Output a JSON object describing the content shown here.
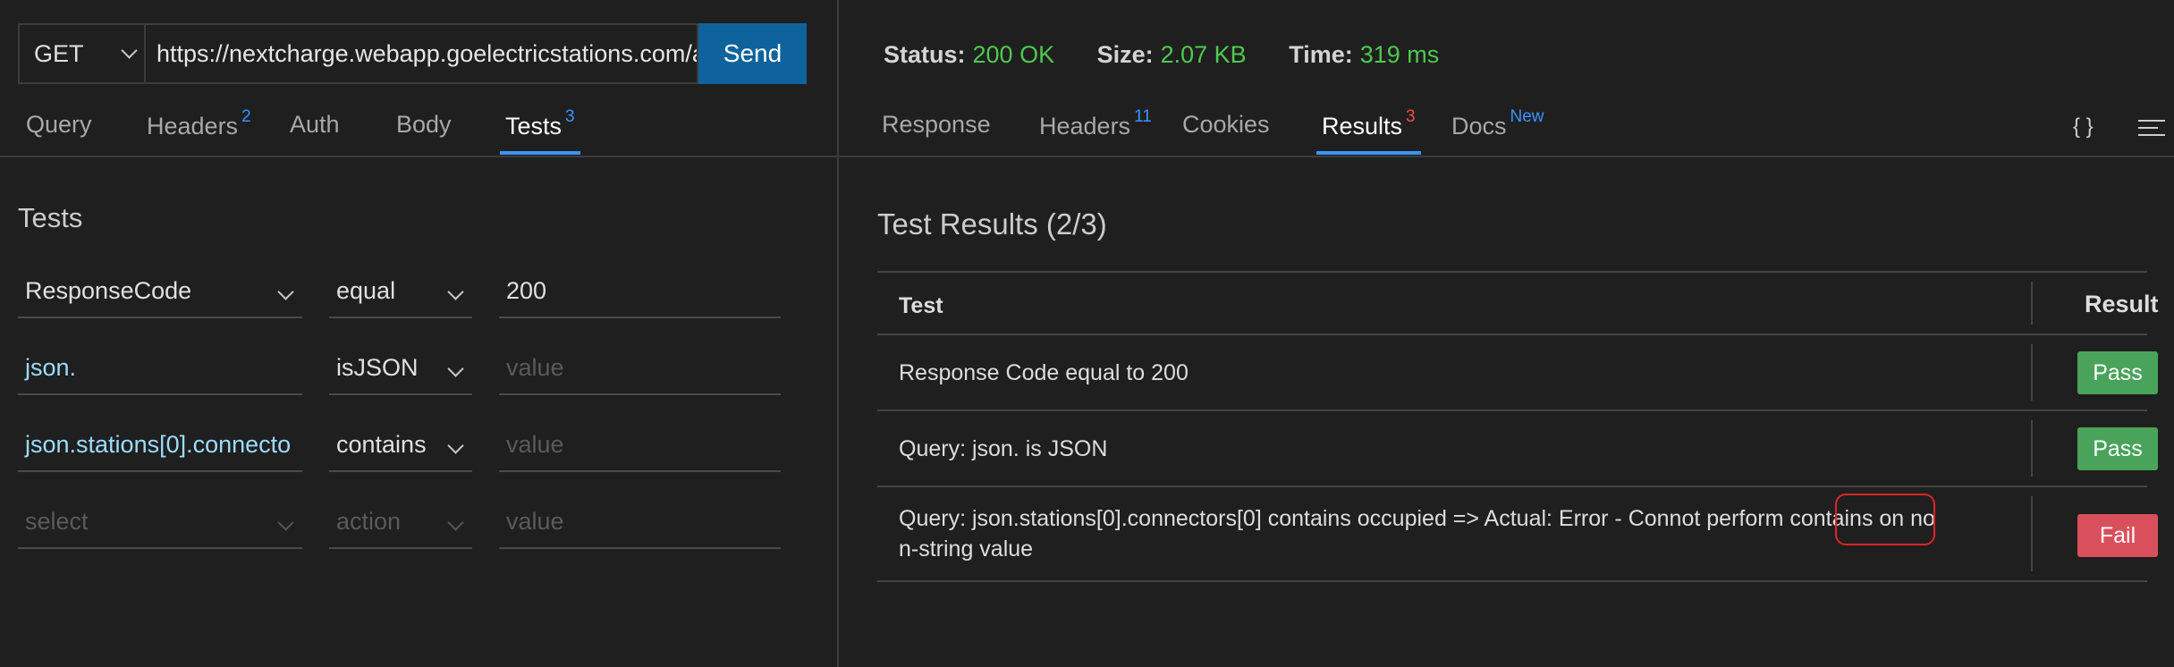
{
  "request": {
    "method": "GET",
    "url": "https://nextcharge.webapp.goelectricstations.com/ap",
    "send_label": "Send"
  },
  "request_tabs": [
    {
      "label": "Query",
      "badge": ""
    },
    {
      "label": "Headers",
      "badge": "2"
    },
    {
      "label": "Auth",
      "badge": ""
    },
    {
      "label": "Body",
      "badge": ""
    },
    {
      "label": "Tests",
      "badge": "3"
    }
  ],
  "tests_section": {
    "title": "Tests",
    "rows": [
      {
        "field": "ResponseCode",
        "action": "equal",
        "value": "200",
        "value_placeholder": ""
      },
      {
        "field": "json.",
        "action": "isJSON",
        "value": "",
        "value_placeholder": "value"
      },
      {
        "field": "json.stations[0].connecto",
        "action": "contains",
        "value": "",
        "value_placeholder": "value"
      },
      {
        "field": "",
        "field_placeholder": "select",
        "action": "",
        "action_placeholder": "action",
        "value": "",
        "value_placeholder": "value"
      }
    ]
  },
  "status": {
    "status_label": "Status:",
    "status_value": "200 OK",
    "size_label": "Size:",
    "size_value": "2.07 KB",
    "time_label": "Time:",
    "time_value": "319 ms",
    "ok_color": "#4ec94e"
  },
  "response_tabs": [
    {
      "label": "Response",
      "badge": ""
    },
    {
      "label": "Headers",
      "badge": "11"
    },
    {
      "label": "Cookies",
      "badge": ""
    },
    {
      "label": "Results",
      "badge": "3"
    },
    {
      "label": "Docs",
      "badge": "New"
    }
  ],
  "toolbar_icons": {
    "braces": "{ }"
  },
  "results": {
    "title": "Test Results (2/3)",
    "col_test": "Test",
    "col_result": "Result",
    "rows": [
      {
        "test": "Response Code equal to 200",
        "result": "Pass"
      },
      {
        "test": "Query: json. is JSON",
        "result": "Pass"
      },
      {
        "test": "Query: json.stations[0].connectors[0] contains occupied => Actual: Error - Connot perform contains on no",
        "test_line2": "n-string value",
        "result": "Fail"
      }
    ]
  },
  "colors": {
    "accent": "#3794ff",
    "send": "#0e639c",
    "pass": "#4aa35a",
    "fail": "#d9505c",
    "highlight": "#e02424"
  }
}
